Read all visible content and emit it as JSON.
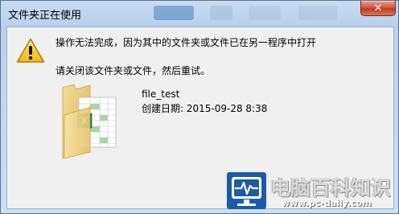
{
  "window": {
    "title": "文件夹正在使用",
    "close_glyph": "✕"
  },
  "message": {
    "main": "操作无法完成，因为其中的文件夹或文件已在另一程序中打开",
    "sub": "请关闭该文件夹或文件，然后重试。"
  },
  "file": {
    "name": "file_test",
    "created": "创建日期: 2015-09-28 8:38",
    "icon": "folder-with-excel-icon"
  },
  "watermark": {
    "title": "电脑百科知识",
    "url": "www.pc-daily.com"
  },
  "icons": {
    "warning": "warning-icon",
    "close": "close-icon"
  },
  "colors": {
    "close_button": "#c7442a",
    "folder": "#e8c873",
    "excel_green": "#1f7a3b",
    "logo_blue": "#1e5aa8"
  }
}
